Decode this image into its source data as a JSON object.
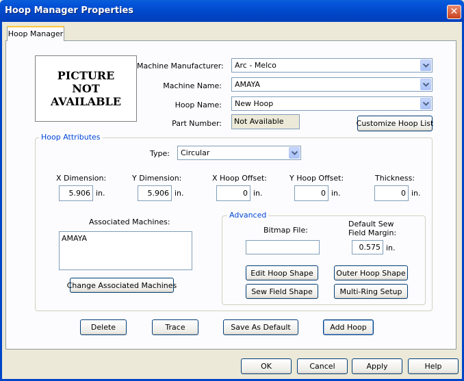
{
  "window": {
    "title": "Hoop Manager Properties"
  },
  "tab": {
    "label": "Hoop Manager"
  },
  "picture": {
    "line1": "PICTURE",
    "line2": "NOT",
    "line3": "AVAILABLE"
  },
  "fields": {
    "manufacturer": {
      "label": "Machine Manufacturer:",
      "value": "Arc - Melco"
    },
    "machine_name": {
      "label": "Machine Name:",
      "value": "AMAYA"
    },
    "hoop_name": {
      "label": "Hoop Name:",
      "value": "New Hoop"
    },
    "part_number": {
      "label": "Part Number:",
      "value": "Not Available"
    }
  },
  "customize_button": "Customize Hoop List",
  "attributes": {
    "title": "Hoop Attributes",
    "type": {
      "label": "Type:",
      "value": "Circular"
    },
    "x_dimension": {
      "label": "X Dimension:",
      "value": "5.906",
      "unit": "in."
    },
    "y_dimension": {
      "label": "Y Dimension:",
      "value": "5.906",
      "unit": "in."
    },
    "x_offset": {
      "label": "X Hoop Offset:",
      "value": "0",
      "unit": "in."
    },
    "y_offset": {
      "label": "Y Hoop Offset:",
      "value": "0",
      "unit": "in."
    },
    "thickness": {
      "label": "Thickness:",
      "value": "0",
      "unit": "in."
    },
    "associated": {
      "label": "Associated Machines:",
      "items": [
        "AMAYA"
      ]
    },
    "change_button": "Change Associated Machines",
    "advanced": {
      "title": "Advanced",
      "bitmap": {
        "label": "Bitmap File:",
        "value": ""
      },
      "margin": {
        "label1": "Default Sew",
        "label2": "Field Margin:",
        "value": "0.575",
        "unit": "in."
      },
      "edit_hoop_shape": "Edit Hoop Shape",
      "outer_hoop_shape": "Outer Hoop Shape",
      "sew_field_shape": "Sew Field Shape",
      "multi_ring_setup": "Multi-Ring Setup"
    }
  },
  "actions": {
    "delete": "Delete",
    "trace": "Trace",
    "save_default": "Save As Default",
    "add_hoop": "Add Hoop"
  },
  "dialog": {
    "ok": "OK",
    "cancel": "Cancel",
    "apply": "Apply",
    "help": "Help"
  },
  "icons": {
    "close": "close-icon",
    "dropdown": "chevron-down-icon"
  },
  "colors": {
    "titlebar": "#0046C8",
    "groupTitle": "#0046D5",
    "face": "#ECE9D8"
  }
}
